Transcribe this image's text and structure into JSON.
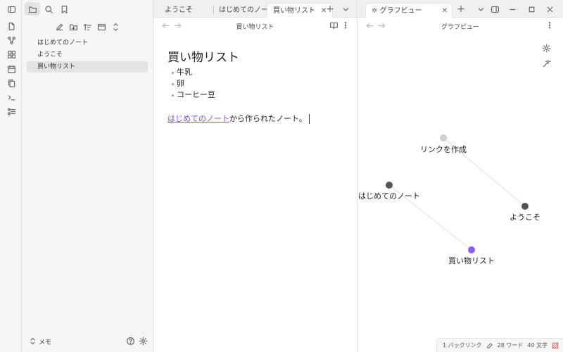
{
  "sidebar": {
    "files": [
      {
        "name": "はじめてのノート"
      },
      {
        "name": "ようこそ"
      },
      {
        "name": "買い物リスト"
      }
    ],
    "vault_name": "メモ"
  },
  "editor": {
    "tabs": [
      {
        "label": "ようこそ"
      },
      {
        "label": "はじめてのノート"
      },
      {
        "label": "買い物リスト"
      }
    ],
    "nav_title": "買い物リスト",
    "note_title": "買い物リスト",
    "bullets": [
      "牛乳",
      "卵",
      "コーヒー豆"
    ],
    "link_text": "はじめてのノート",
    "body_suffix": "から作られたノート。"
  },
  "graph": {
    "tab_label": "グラフビュー",
    "nav_title": "グラフビュー",
    "nodes": [
      {
        "label": "リンクを作成",
        "color": "#cfcfcf"
      },
      {
        "label": "はじめてのノート",
        "color": "#555555"
      },
      {
        "label": "ようこそ",
        "color": "#555555"
      },
      {
        "label": "買い物リスト",
        "color": "#8a5cf5"
      }
    ]
  },
  "status": {
    "backlinks": "1 バックリンク",
    "words": "28 ワード",
    "chars": "40 文字"
  },
  "colors": {
    "accent": "#8a5cf5",
    "link": "#7c4fdf"
  }
}
